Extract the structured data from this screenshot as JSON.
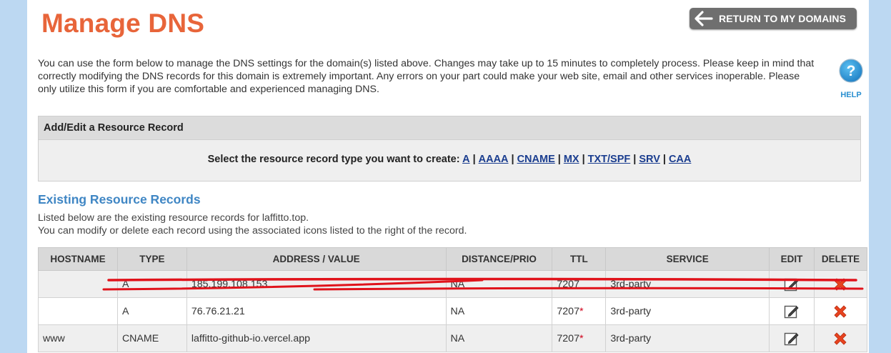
{
  "header": {
    "title": "Manage DNS",
    "return_label": "RETURN TO MY DOMAINS",
    "return_icon": "arrow-left-icon"
  },
  "intro_text": "You can use the form below to manage the DNS settings for the domain(s) listed above. Changes may take up to 15 minutes to completely process. Please keep in mind that correctly modifying the DNS records for this domain is extremely important. Any errors on your part could make your web site, email and other services inoperable. Please only utilize this form if you are comfortable and experienced managing DNS.",
  "help": {
    "label": "HELP",
    "icon": "question-mark-icon"
  },
  "add_panel": {
    "heading": "Add/Edit a Resource Record",
    "prompt": "Select the resource record type you want to create:",
    "types": [
      "A",
      "AAAA",
      "CNAME",
      "MX",
      "TXT/SPF",
      "SRV",
      "CAA"
    ],
    "separator": "|"
  },
  "existing": {
    "title": "Existing Resource Records",
    "line1": "Listed below are the existing resource records for laffitto.top.",
    "line2": "You can modify or delete each record using the associated icons listed to the right of the record."
  },
  "table": {
    "columns": [
      "HOSTNAME",
      "TYPE",
      "ADDRESS / VALUE",
      "DISTANCE/PRIO",
      "TTL",
      "SERVICE",
      "EDIT",
      "DELETE"
    ],
    "rows": [
      {
        "hostname": "",
        "type": "A",
        "address": "185.199.108.153",
        "prio": "NA",
        "ttl": "7207",
        "ttl_flag": "",
        "service": "3rd-party",
        "struck": true
      },
      {
        "hostname": "",
        "type": "A",
        "address": "76.76.21.21",
        "prio": "NA",
        "ttl": "7207",
        "ttl_flag": "*",
        "service": "3rd-party",
        "struck": false
      },
      {
        "hostname": "www",
        "type": "CNAME",
        "address": "laffitto-github-io.vercel.app",
        "prio": "NA",
        "ttl": "7207",
        "ttl_flag": "*",
        "service": "3rd-party",
        "struck": false
      }
    ],
    "edit_icon": "pencil-edit-icon",
    "delete_icon": "red-x-delete-icon"
  },
  "colors": {
    "title": "#e8653a",
    "link": "#1a3d8f",
    "section_title": "#3f86c4",
    "help": "#2a8fd0",
    "delete": "#e8431f",
    "strike": "#e0131b",
    "background": "#bcd8f2"
  }
}
